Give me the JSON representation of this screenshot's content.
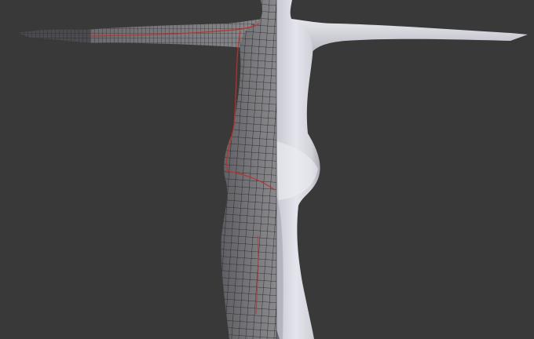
{
  "viewport": {
    "background": "#393939",
    "mode": "3d-viewport",
    "shading": "solid-with-mirrored-wireframe-half",
    "colors": {
      "solid_light": "#e2e2ea",
      "solid_mid": "#b9b9c2",
      "solid_dark": "#8f8f98",
      "wire_face": "#6e6e72",
      "wire_edge": "#1a1a1a",
      "seam": "#c0302a"
    }
  },
  "model": {
    "pose": "t-pose",
    "view": "rear",
    "halves": [
      "wireframe-left",
      "solid-right"
    ]
  }
}
